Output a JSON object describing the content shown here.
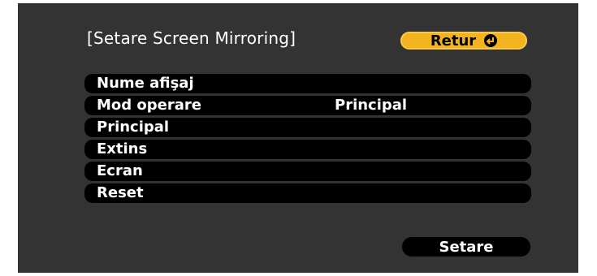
{
  "dialog": {
    "title": "[Setare Screen Mirroring]",
    "back_label": "Retur",
    "back_icon": "enter-icon"
  },
  "menu": {
    "items": [
      {
        "label": "Nume afişaj",
        "value": ""
      },
      {
        "label": "Mod operare",
        "value": "Principal"
      },
      {
        "label": "Principal",
        "value": ""
      },
      {
        "label": "Extins",
        "value": ""
      },
      {
        "label": "Ecran",
        "value": ""
      },
      {
        "label": "Reset",
        "value": ""
      }
    ]
  },
  "footer": {
    "set_label": "Setare"
  },
  "colors": {
    "background": "#333333",
    "highlight": "#f2b31f",
    "item": "#000000",
    "text": "#ffffff"
  }
}
